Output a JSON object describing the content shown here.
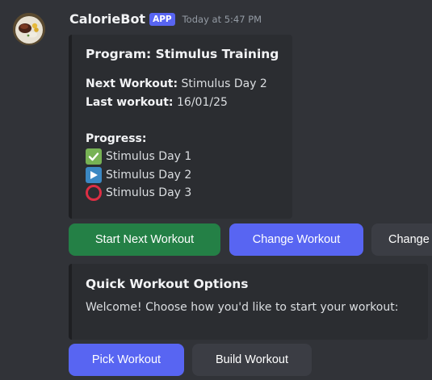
{
  "message": {
    "username": "CalorieBot",
    "badge": "APP",
    "timestamp": "Today at 5:47 PM",
    "avatar_icon": "food-plate-avatar"
  },
  "program_embed": {
    "title": "Program: Stimulus Training",
    "next_workout_label": "Next Workout:",
    "next_workout_value": "Stimulus Day 2",
    "last_workout_label": "Last workout:",
    "last_workout_value": "16/01/25",
    "progress_label": "Progress:",
    "progress_items": [
      {
        "icon": "check-mark-icon",
        "label": "Stimulus Day 1"
      },
      {
        "icon": "play-icon",
        "label": "Stimulus Day 2"
      },
      {
        "icon": "hollow-circle-icon",
        "label": "Stimulus Day 3"
      }
    ]
  },
  "program_buttons": {
    "start_next": "Start Next Workout",
    "change_workout": "Change Workout",
    "change_partial": "Change"
  },
  "quick_embed": {
    "title": "Quick Workout Options",
    "description": "Welcome! Choose how you'd like to start your workout:"
  },
  "quick_buttons": {
    "pick": "Pick Workout",
    "build": "Build Workout"
  },
  "colors": {
    "background": "#313338",
    "embed_bg": "#2b2d31",
    "blurple": "#5865f2",
    "green": "#248046",
    "secondary": "#3b3d44"
  }
}
